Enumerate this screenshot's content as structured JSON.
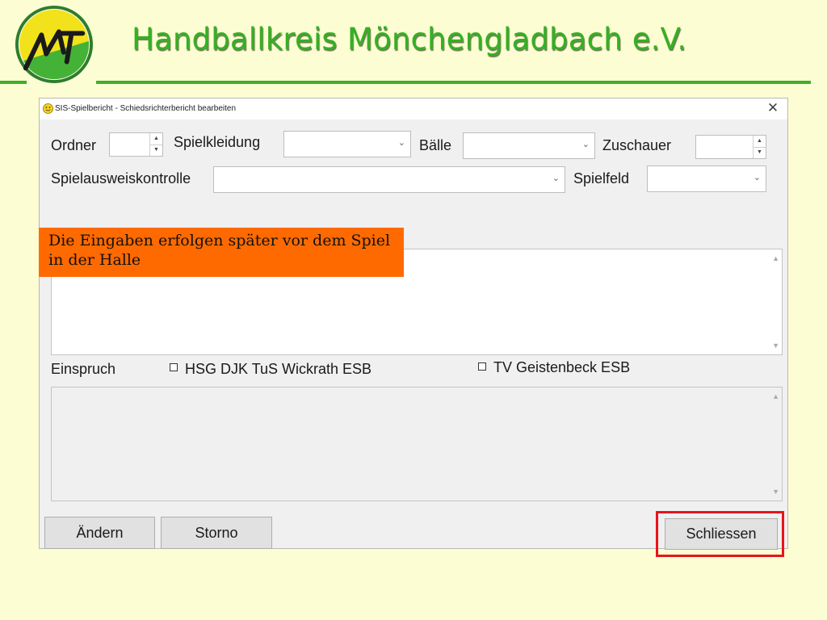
{
  "slide": {
    "title": "Handballkreis Mönchengladbach e.V.",
    "logo_colors": {
      "ring": "#2e7d2e",
      "top": "#f2e21c",
      "bottom": "#44b236"
    }
  },
  "dialog": {
    "title": "SIS-Spielbericht - Schiedsrichterbericht bearbeiten",
    "close_glyph": "✕",
    "fields": {
      "ordner_label": "Ordner",
      "spielkleidung_label": "Spielkleidung",
      "baelle_label": "Bälle",
      "zuschauer_label": "Zuschauer",
      "spielausweiskontrolle_label": "Spielausweiskontrolle",
      "spielfeld_label": "Spielfeld",
      "einspruch_label": "Einspruch"
    },
    "checkboxes": {
      "team_home": "HSG DJK TuS Wickrath ESB",
      "team_guest": "TV Geistenbeck ESB"
    },
    "buttons": {
      "aendern": "Ändern",
      "storno": "Storno",
      "schliessen": "Schliessen"
    }
  },
  "callout": {
    "text": "Die Eingaben erfolgen später vor dem Spiel in der Halle"
  },
  "colors": {
    "callout_bg": "#ff6a00",
    "highlight_border": "#e8141b",
    "title_green": "#35b024",
    "slide_bg": "#fdfdd3"
  }
}
